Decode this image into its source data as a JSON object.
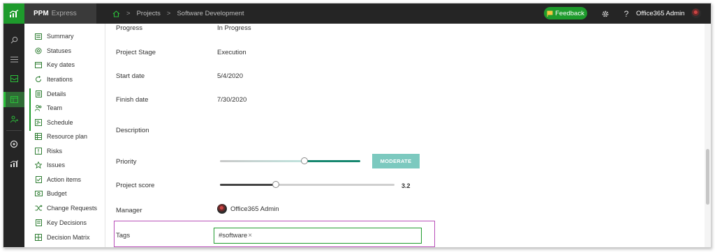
{
  "app": {
    "brand_primary": "PPM",
    "brand_secondary": "Express"
  },
  "breadcrumb": {
    "home_icon": "home-icon",
    "items": [
      "Projects",
      "Software Development"
    ],
    "separator": ">"
  },
  "header": {
    "feedback_label": "Feedback",
    "help_glyph": "?",
    "user_name": "Office365 Admin"
  },
  "sidenav": {
    "items": [
      {
        "label": "Summary",
        "icon": "summary-icon"
      },
      {
        "label": "Statuses",
        "icon": "statuses-icon"
      },
      {
        "label": "Key dates",
        "icon": "calendar-icon"
      },
      {
        "label": "Iterations",
        "icon": "iterations-icon"
      },
      {
        "label": "Details",
        "icon": "details-icon"
      },
      {
        "label": "Team",
        "icon": "team-icon"
      },
      {
        "label": "Schedule",
        "icon": "schedule-icon"
      },
      {
        "label": "Resource plan",
        "icon": "resource-plan-icon"
      },
      {
        "label": "Risks",
        "icon": "risks-icon"
      },
      {
        "label": "Issues",
        "icon": "issues-icon"
      },
      {
        "label": "Action items",
        "icon": "action-items-icon"
      },
      {
        "label": "Budget",
        "icon": "budget-icon"
      },
      {
        "label": "Change Requests",
        "icon": "change-requests-icon"
      },
      {
        "label": "Key Decisions",
        "icon": "key-decisions-icon"
      },
      {
        "label": "Decision Matrix",
        "icon": "decision-matrix-icon"
      }
    ]
  },
  "details": {
    "progress": {
      "label": "Progress",
      "value": "In Progress"
    },
    "stage": {
      "label": "Project Stage",
      "value": "Execution"
    },
    "start": {
      "label": "Start date",
      "value": "5/4/2020"
    },
    "finish": {
      "label": "Finish date",
      "value": "7/30/2020"
    },
    "description": {
      "label": "Description",
      "value": ""
    },
    "priority": {
      "label": "Priority",
      "value_label": "MODERATE",
      "level": 0.6
    },
    "score": {
      "label": "Project score",
      "value": "3.2",
      "level": 0.32
    },
    "manager": {
      "label": "Manager",
      "value": "Office365 Admin"
    },
    "tags": {
      "label": "Tags",
      "items": [
        "#software"
      ],
      "remove_glyph": "×"
    }
  },
  "colors": {
    "accent": "#1e9b2c",
    "priority_track": "#16876f",
    "priority_badge": "#7cc9bf",
    "highlight": "#b84db8",
    "topbar": "#252525"
  }
}
